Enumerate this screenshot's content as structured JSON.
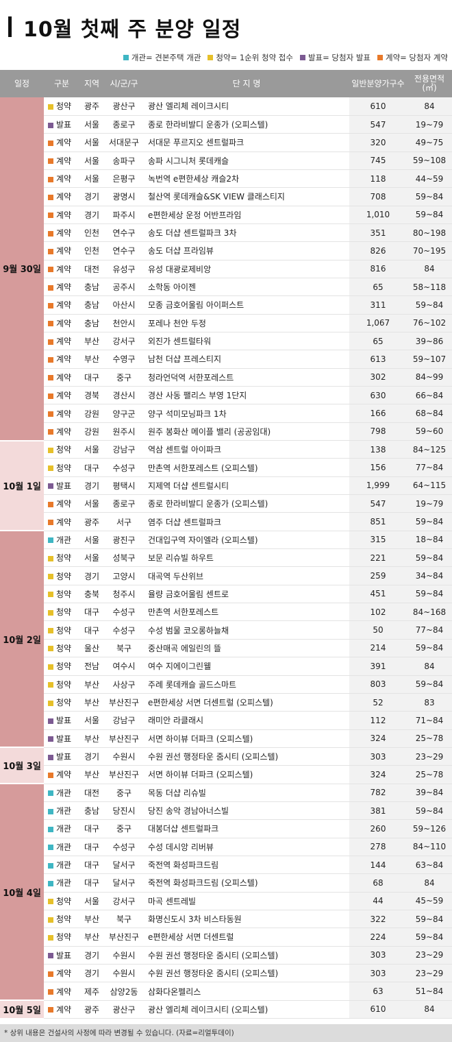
{
  "title": "10월 첫째 주 분양 일정",
  "legend": [
    {
      "label": "개관= 견본주택 개관",
      "color": "#3fb6c3"
    },
    {
      "label": "청약= 1순위 청약 접수",
      "color": "#e6c02a"
    },
    {
      "label": "발표= 당첨자 발표",
      "color": "#7c5a92"
    },
    {
      "label": "계약= 당첨자 계약",
      "color": "#e8792a"
    }
  ],
  "headers": {
    "date": "일정",
    "kind": "구분",
    "region": "지역",
    "city": "시/군/구",
    "name": "단   지   명",
    "units": "일반분양가구수",
    "area": "전용면적(㎡)"
  },
  "kind_colors": {
    "개관": "#3fb6c3",
    "청약": "#e6c02a",
    "발표": "#7c5a92",
    "계약": "#e8792a"
  },
  "groups": [
    {
      "date": "9월 30일",
      "shade": "c1",
      "rows": [
        {
          "kind": "청약",
          "region": "광주",
          "city": "광산구",
          "name": "광산 엘리체 레이크시티",
          "units": "610",
          "area": "84"
        },
        {
          "kind": "발표",
          "region": "서울",
          "city": "종로구",
          "name": "종로 한라비발디 운종가 (오피스텔)",
          "units": "547",
          "area": "19~79"
        },
        {
          "kind": "계약",
          "region": "서울",
          "city": "서대문구",
          "name": "서대문 푸르지오 센트럴파크",
          "units": "320",
          "area": "49~75"
        },
        {
          "kind": "계약",
          "region": "서울",
          "city": "송파구",
          "name": "송파 시그니처 롯데캐슬",
          "units": "745",
          "area": "59~108"
        },
        {
          "kind": "계약",
          "region": "서울",
          "city": "은평구",
          "name": "녹번역 e편한세상 캐슬2차",
          "units": "118",
          "area": "44~59"
        },
        {
          "kind": "계약",
          "region": "경기",
          "city": "광명시",
          "name": "철산역 롯데캐슬&SK VIEW 클래스티지",
          "units": "708",
          "area": "59~84"
        },
        {
          "kind": "계약",
          "region": "경기",
          "city": "파주시",
          "name": "e편한세상 운정 어반프라임",
          "units": "1,010",
          "area": "59~84"
        },
        {
          "kind": "계약",
          "region": "인천",
          "city": "연수구",
          "name": "송도 더샵 센트럴파크 3차",
          "units": "351",
          "area": "80~198"
        },
        {
          "kind": "계약",
          "region": "인천",
          "city": "연수구",
          "name": "송도 더샵 프라임뷰",
          "units": "826",
          "area": "70~195"
        },
        {
          "kind": "계약",
          "region": "대전",
          "city": "유성구",
          "name": "유성 대광로제비앙",
          "units": "816",
          "area": "84"
        },
        {
          "kind": "계약",
          "region": "충남",
          "city": "공주시",
          "name": "소학동 아이젠",
          "units": "65",
          "area": "58~118"
        },
        {
          "kind": "계약",
          "region": "충남",
          "city": "아산시",
          "name": "모종 금호어울림 아이퍼스트",
          "units": "311",
          "area": "59~84"
        },
        {
          "kind": "계약",
          "region": "충남",
          "city": "천안시",
          "name": "포레나 천안 두정",
          "units": "1,067",
          "area": "76~102"
        },
        {
          "kind": "계약",
          "region": "부산",
          "city": "강서구",
          "name": "외진가 센트럴타워",
          "units": "65",
          "area": "39~86"
        },
        {
          "kind": "계약",
          "region": "부산",
          "city": "수영구",
          "name": "남천 더샵 프레스티지",
          "units": "613",
          "area": "59~107"
        },
        {
          "kind": "계약",
          "region": "대구",
          "city": "중구",
          "name": "청라언덕역 서한포레스트",
          "units": "302",
          "area": "84~99"
        },
        {
          "kind": "계약",
          "region": "경북",
          "city": "경산시",
          "name": "경산 사동 팰리스 부영 1단지",
          "units": "630",
          "area": "66~84"
        },
        {
          "kind": "계약",
          "region": "강원",
          "city": "양구군",
          "name": "양구 석미모닝파크 1차",
          "units": "166",
          "area": "68~84"
        },
        {
          "kind": "계약",
          "region": "강원",
          "city": "원주시",
          "name": "원주 봉화산 메이플 밸리 (공공임대)",
          "units": "798",
          "area": "59~60"
        }
      ]
    },
    {
      "date": "10월 1일",
      "shade": "c2",
      "rows": [
        {
          "kind": "청약",
          "region": "서울",
          "city": "강남구",
          "name": "역삼 센트럴 아이파크",
          "units": "138",
          "area": "84~125"
        },
        {
          "kind": "청약",
          "region": "대구",
          "city": "수성구",
          "name": "만촌역 서한포레스트 (오피스텔)",
          "units": "156",
          "area": "77~84"
        },
        {
          "kind": "발표",
          "region": "경기",
          "city": "평택시",
          "name": "지제역 더샵 센트럴시티",
          "units": "1,999",
          "area": "64~115"
        },
        {
          "kind": "계약",
          "region": "서울",
          "city": "종로구",
          "name": "종로 한라비발디 운종가 (오피스텔)",
          "units": "547",
          "area": "19~79"
        },
        {
          "kind": "계약",
          "region": "광주",
          "city": "서구",
          "name": "염주 더샵 센트럴파크",
          "units": "851",
          "area": "59~84"
        }
      ]
    },
    {
      "date": "10월 2일",
      "shade": "c1",
      "rows": [
        {
          "kind": "개관",
          "region": "서울",
          "city": "광진구",
          "name": "건대입구역 자이엘라 (오피스텔)",
          "units": "315",
          "area": "18~84"
        },
        {
          "kind": "청약",
          "region": "서울",
          "city": "성북구",
          "name": "보문 리슈빌 하우트",
          "units": "221",
          "area": "59~84"
        },
        {
          "kind": "청약",
          "region": "경기",
          "city": "고양시",
          "name": "대곡역 두산위브",
          "units": "259",
          "area": "34~84"
        },
        {
          "kind": "청약",
          "region": "충북",
          "city": "청주시",
          "name": "율량 금호어울림 센트로",
          "units": "451",
          "area": "59~84"
        },
        {
          "kind": "청약",
          "region": "대구",
          "city": "수성구",
          "name": "만촌역 서한포레스트",
          "units": "102",
          "area": "84~168"
        },
        {
          "kind": "청약",
          "region": "대구",
          "city": "수성구",
          "name": "수성 범물 코오롱하늘채",
          "units": "50",
          "area": "77~84"
        },
        {
          "kind": "청약",
          "region": "울산",
          "city": "북구",
          "name": "중산매곡 에일린의 뜰",
          "units": "214",
          "area": "59~84"
        },
        {
          "kind": "청약",
          "region": "전남",
          "city": "여수시",
          "name": "여수 지에이그린웰",
          "units": "391",
          "area": "84"
        },
        {
          "kind": "청약",
          "region": "부산",
          "city": "사상구",
          "name": "주례 롯데캐슬 골드스마트",
          "units": "803",
          "area": "59~84"
        },
        {
          "kind": "청약",
          "region": "부산",
          "city": "부산진구",
          "name": "e편한세상 서면 더센트럴 (오피스텔)",
          "units": "52",
          "area": "83"
        },
        {
          "kind": "발표",
          "region": "서울",
          "city": "강남구",
          "name": "래미안 라클래시",
          "units": "112",
          "area": "71~84"
        },
        {
          "kind": "발표",
          "region": "부산",
          "city": "부산진구",
          "name": "서면 하이뷰 더파크 (오피스텔)",
          "units": "324",
          "area": "25~78"
        }
      ]
    },
    {
      "date": "10월 3일",
      "shade": "c2",
      "rows": [
        {
          "kind": "발표",
          "region": "경기",
          "city": "수원시",
          "name": "수원 권선 행정타운 줌시티 (오피스텔)",
          "units": "303",
          "area": "23~29"
        },
        {
          "kind": "계약",
          "region": "부산",
          "city": "부산진구",
          "name": "서면 하이뷰 더파크 (오피스텔)",
          "units": "324",
          "area": "25~78"
        }
      ]
    },
    {
      "date": "10월 4일",
      "shade": "c1",
      "rows": [
        {
          "kind": "개관",
          "region": "대전",
          "city": "중구",
          "name": "목동 더샵 리슈빌",
          "units": "782",
          "area": "39~84"
        },
        {
          "kind": "개관",
          "region": "충남",
          "city": "당진시",
          "name": "당진 송악 경남아너스빌",
          "units": "381",
          "area": "59~84"
        },
        {
          "kind": "개관",
          "region": "대구",
          "city": "중구",
          "name": "대봉더샵 센트럴파크",
          "units": "260",
          "area": "59~126"
        },
        {
          "kind": "개관",
          "region": "대구",
          "city": "수성구",
          "name": "수성 데시앙 리버뷰",
          "units": "278",
          "area": "84~110"
        },
        {
          "kind": "개관",
          "region": "대구",
          "city": "달서구",
          "name": "죽전역 화성파크드림",
          "units": "144",
          "area": "63~84"
        },
        {
          "kind": "개관",
          "region": "대구",
          "city": "달서구",
          "name": "죽전역 화성파크드림 (오피스텔)",
          "units": "68",
          "area": "84"
        },
        {
          "kind": "청약",
          "region": "서울",
          "city": "강서구",
          "name": "마곡 센트레빌",
          "units": "44",
          "area": "45~59"
        },
        {
          "kind": "청약",
          "region": "부산",
          "city": "북구",
          "name": "화명신도시 3차 비스타동원",
          "units": "322",
          "area": "59~84"
        },
        {
          "kind": "청약",
          "region": "부산",
          "city": "부산진구",
          "name": "e편한세상 서면 더센트럴",
          "units": "224",
          "area": "59~84"
        },
        {
          "kind": "발표",
          "region": "경기",
          "city": "수원시",
          "name": "수원 권선 행정타운 줌시티 (오피스텔)",
          "units": "303",
          "area": "23~29"
        },
        {
          "kind": "계약",
          "region": "경기",
          "city": "수원시",
          "name": "수원 권선 행정타운 줌시티 (오피스텔)",
          "units": "303",
          "area": "23~29"
        },
        {
          "kind": "계약",
          "region": "제주",
          "city": "삼양2동",
          "name": "삼화다온펠리스",
          "units": "63",
          "area": "51~84"
        }
      ]
    },
    {
      "date": "10월 5일",
      "shade": "c2",
      "rows": [
        {
          "kind": "계약",
          "region": "광주",
          "city": "광산구",
          "name": "광산 엘리체 레이크시티 (오피스텔)",
          "units": "610",
          "area": "84"
        }
      ]
    }
  ],
  "footnote": "* 상위 내용은 건설사의 사정에 따라 변경될 수 있습니다. (자료=리얼투데이)"
}
